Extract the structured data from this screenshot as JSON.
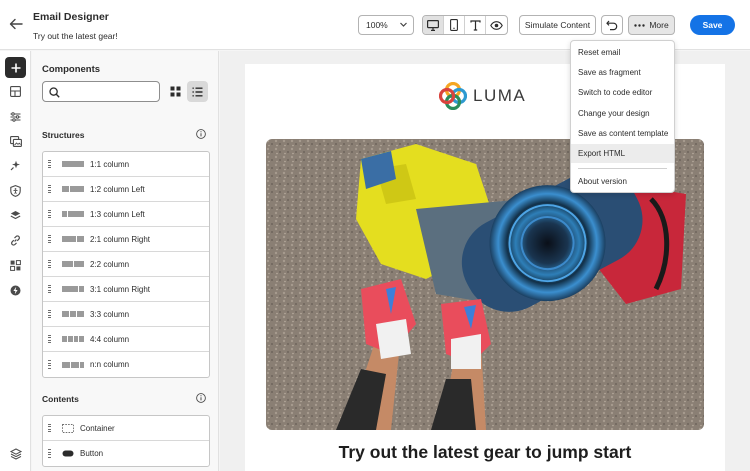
{
  "header": {
    "title": "Email Designer",
    "subtitle": "Try out the latest gear!",
    "zoom": "100%",
    "simulate_label": "Simulate Content",
    "more_label": "More",
    "save_label": "Save"
  },
  "more_menu": {
    "items": [
      "Reset email",
      "Save as fragment",
      "Switch to code editor",
      "Change your design",
      "Save as content template",
      "Export HTML"
    ],
    "footer_item": "About version",
    "hovered": "Export HTML"
  },
  "panel": {
    "title": "Components",
    "search_placeholder": "",
    "structures_title": "Structures",
    "structures": [
      {
        "label": "1:1 column",
        "cols": [
          1
        ]
      },
      {
        "label": "1:2 column Left",
        "cols": [
          1,
          2
        ]
      },
      {
        "label": "1:3 column Left",
        "cols": [
          1,
          3
        ]
      },
      {
        "label": "2:1 column Right",
        "cols": [
          2,
          1
        ]
      },
      {
        "label": "2:2 column",
        "cols": [
          1,
          1
        ]
      },
      {
        "label": "3:1 column Right",
        "cols": [
          3,
          1
        ]
      },
      {
        "label": "3:3 column",
        "cols": [
          1,
          1,
          1
        ]
      },
      {
        "label": "4:4 column",
        "cols": [
          1,
          1,
          1,
          1
        ]
      },
      {
        "label": "n:n column",
        "cols": [
          1,
          1,
          0.5
        ]
      }
    ],
    "contents_title": "Contents",
    "contents": [
      "Container",
      "Button"
    ]
  },
  "email": {
    "brand": "LUMA",
    "headline": "Try out the latest gear to jump start"
  },
  "colors": {
    "accent": "#1473e6",
    "header_bg": "#ffffff",
    "canvas_bg": "#f0f0f0"
  },
  "icons": {
    "back": "arrow-left-icon",
    "rail": [
      "add-icon",
      "fragments-icon",
      "settings-sliders-icon",
      "assets-icon",
      "personalization-icon",
      "accessibility-icon",
      "layers-icon",
      "link-icon",
      "grid-icon",
      "lightning-icon",
      "layers-bottom-icon"
    ]
  }
}
